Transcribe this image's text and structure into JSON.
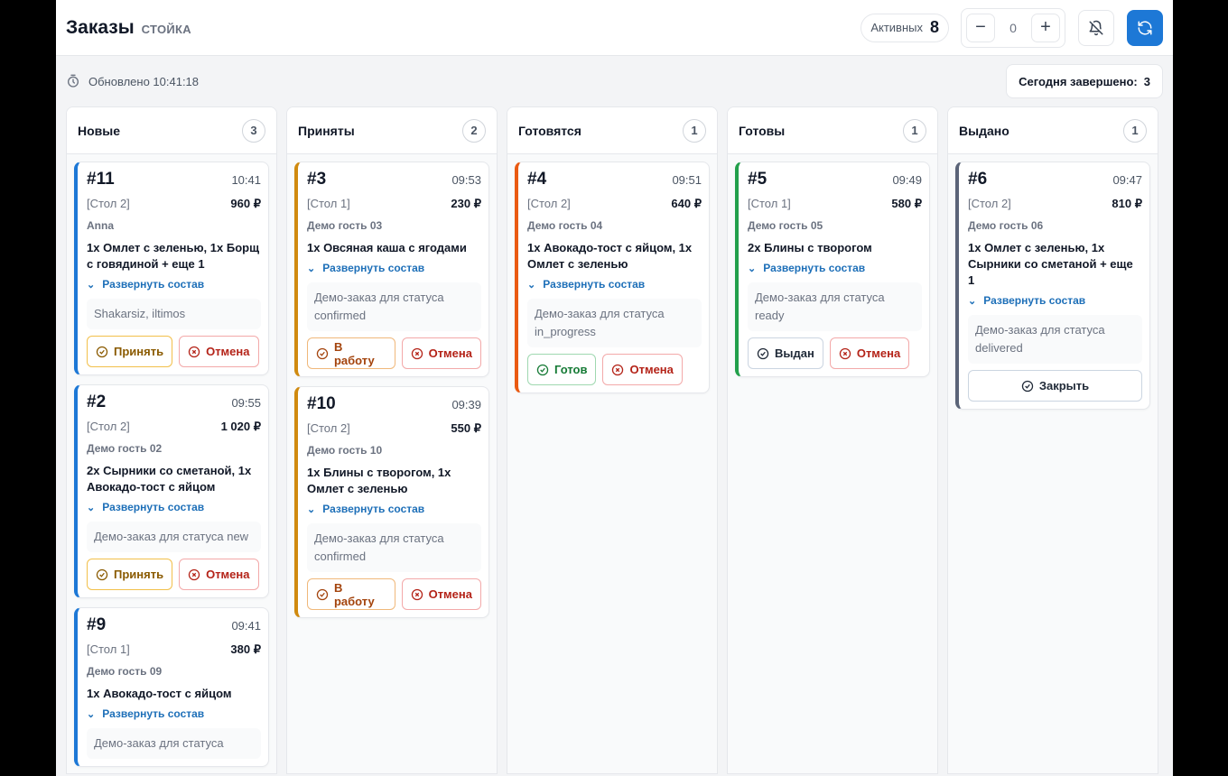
{
  "header": {
    "title": "Заказы",
    "subtitle": "СТОЙКА",
    "active_label": "Активных",
    "active_count": "8",
    "stepper_minus": "−",
    "stepper_value": "0",
    "stepper_plus": "+"
  },
  "subbar": {
    "updated": "Обновлено 10:41:18",
    "done_label": "Сегодня завершено:",
    "done_value": "3"
  },
  "colors": {
    "primary": "#1d78d6",
    "new": "#1d78d6",
    "confirmed": "#d08a0f",
    "in_progress": "#ea5a12",
    "ready": "#22a04b",
    "delivered": "#5b6478"
  },
  "columns": [
    {
      "title": "Новые",
      "count": "3",
      "cards": [
        {
          "num": "#11",
          "time": "10:41",
          "table": "[Стол 2]",
          "price": "960 ₽",
          "guest": "Anna",
          "items": "1x Омлет с зеленью, 1x Борщ с говядиной + еще 1",
          "expand": "Развернуть состав",
          "note": "Shakarsiz, iltimos",
          "btn1": "Принять",
          "btn2": "Отмена"
        },
        {
          "num": "#2",
          "time": "09:55",
          "table": "[Стол 2]",
          "price": "1 020 ₽",
          "guest": "Демо гость 02",
          "items": "2x Сырники со сметаной, 1x Авокадо-тост с яйцом",
          "expand": "Развернуть состав",
          "note": "Демо-заказ для статуса new",
          "btn1": "Принять",
          "btn2": "Отмена"
        },
        {
          "num": "#9",
          "time": "09:41",
          "table": "[Стол 1]",
          "price": "380 ₽",
          "guest": "Демо гость 09",
          "items": "1x Авокадо-тост с яйцом",
          "expand": "Развернуть состав",
          "note": "Демо-заказ для статуса",
          "btn1": "",
          "btn2": ""
        }
      ]
    },
    {
      "title": "Приняты",
      "count": "2",
      "cards": [
        {
          "num": "#3",
          "time": "09:53",
          "table": "[Стол 1]",
          "price": "230 ₽",
          "guest": "Демо гость 03",
          "items": "1x Овсяная каша с ягодами",
          "expand": "Развернуть состав",
          "note": "Демо-заказ для статуса confirmed",
          "btn1": "В работу",
          "btn2": "Отмена"
        },
        {
          "num": "#10",
          "time": "09:39",
          "table": "[Стол 2]",
          "price": "550 ₽",
          "guest": "Демо гость 10",
          "items": "1x Блины с творогом, 1x Омлет с зеленью",
          "expand": "Развернуть состав",
          "note": "Демо-заказ для статуса confirmed",
          "btn1": "В работу",
          "btn2": "Отмена"
        }
      ]
    },
    {
      "title": "Готовятся",
      "count": "1",
      "cards": [
        {
          "num": "#4",
          "time": "09:51",
          "table": "[Стол 2]",
          "price": "640 ₽",
          "guest": "Демо гость 04",
          "items": "1x Авокадо-тост с яйцом, 1x Омлет с зеленью",
          "expand": "Развернуть состав",
          "note": "Демо-заказ для статуса in_progress",
          "btn1": "Готов",
          "btn2": "Отмена"
        }
      ]
    },
    {
      "title": "Готовы",
      "count": "1",
      "cards": [
        {
          "num": "#5",
          "time": "09:49",
          "table": "[Стол 1]",
          "price": "580 ₽",
          "guest": "Демо гость 05",
          "items": "2x Блины с творогом",
          "expand": "Развернуть состав",
          "note": "Демо-заказ для статуса ready",
          "btn1": "Выдан",
          "btn2": "Отмена"
        }
      ]
    },
    {
      "title": "Выдано",
      "count": "1",
      "cards": [
        {
          "num": "#6",
          "time": "09:47",
          "table": "[Стол 2]",
          "price": "810 ₽",
          "guest": "Демо гость 06",
          "items": "1x Омлет с зеленью, 1x Сырники со сметаной + еще 1",
          "expand": "Развернуть состав",
          "note": "Демо-заказ для статуса delivered",
          "btn1": "Закрыть"
        }
      ]
    }
  ]
}
